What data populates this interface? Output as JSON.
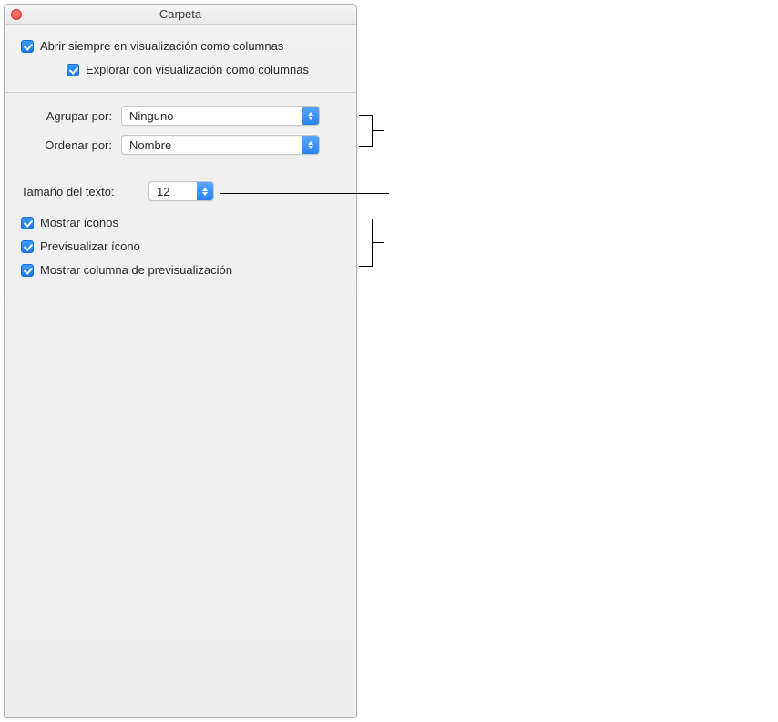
{
  "window": {
    "title": "Carpeta"
  },
  "top": {
    "always_open_label": "Abrir siempre en visualización como columnas",
    "browse_label": "Explorar con visualización como columnas"
  },
  "grouping": {
    "group_by_label": "Agrupar por:",
    "group_by_value": "Ninguno",
    "sort_by_label": "Ordenar por:",
    "sort_by_value": "Nombre"
  },
  "textsize": {
    "label": "Tamaño del texto:",
    "value": "12"
  },
  "bottom_checks": {
    "show_icons": "Mostrar íconos",
    "preview_icon": "Previsualizar ícono",
    "show_preview_column": "Mostrar columna de previsualización"
  }
}
